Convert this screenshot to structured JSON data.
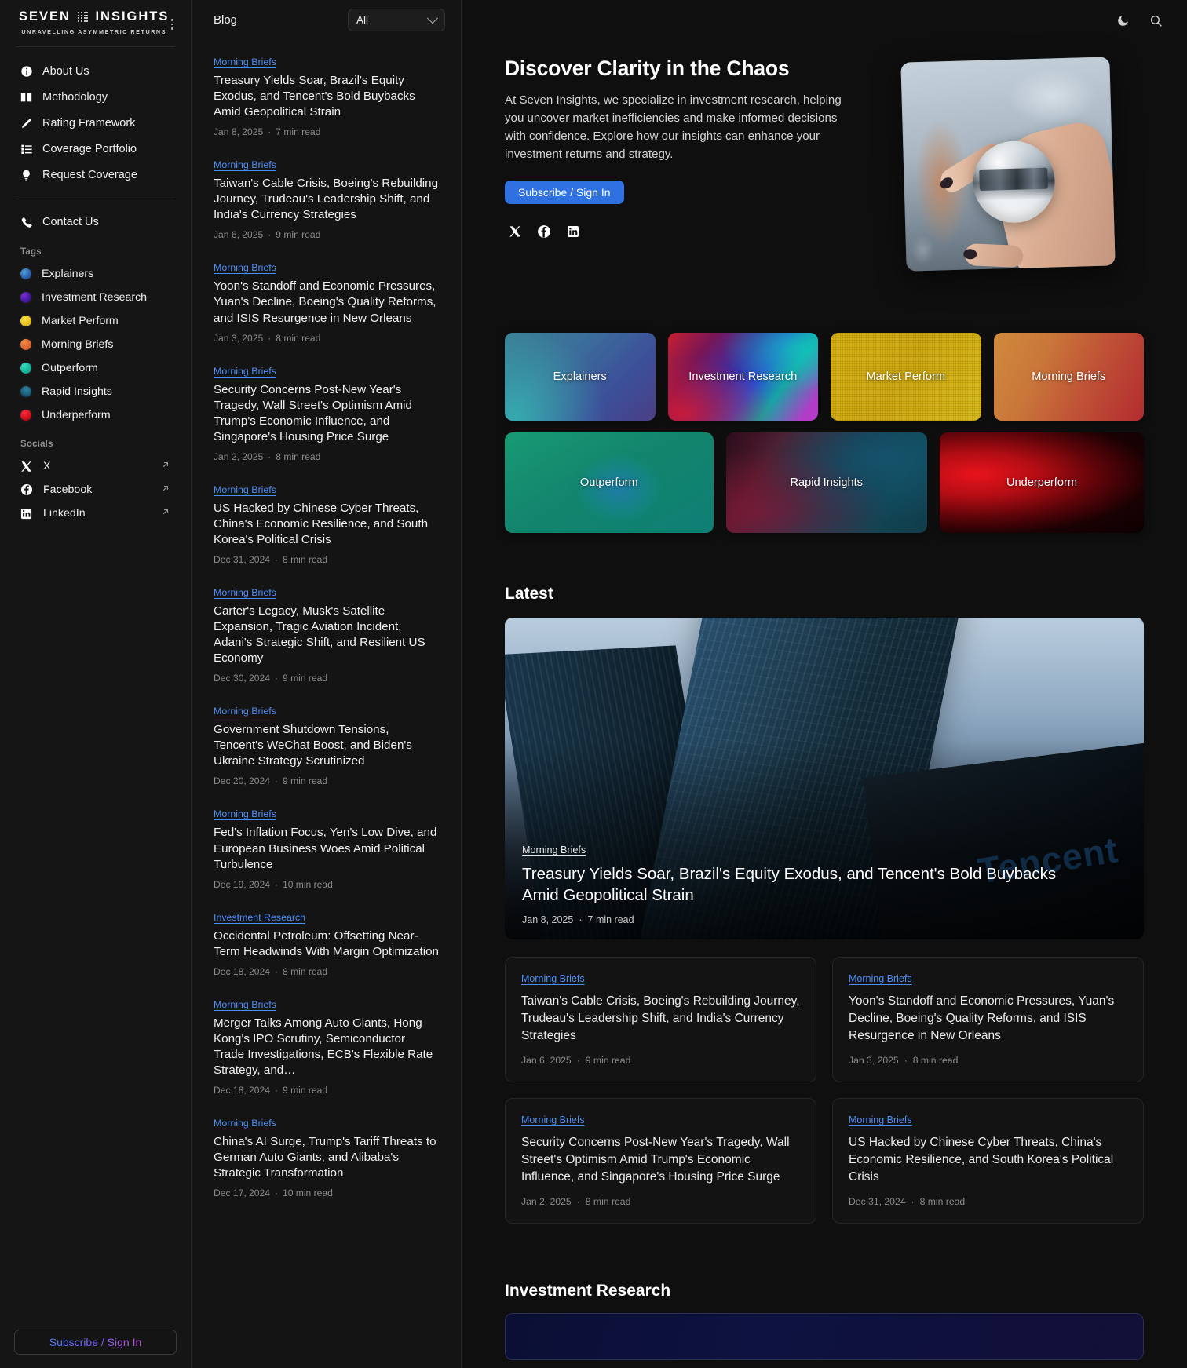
{
  "brand": {
    "word1": "SEVEN",
    "word2": "INSIGHTS",
    "tagline": "UNRAVELLING ASYMMETRIC RETURNS",
    "menu_icon": "kebab-menu-icon"
  },
  "sidebar": {
    "nav": [
      {
        "label": "About Us",
        "icon": "info-icon"
      },
      {
        "label": "Methodology",
        "icon": "book-icon"
      },
      {
        "label": "Rating Framework",
        "icon": "pencil-icon"
      },
      {
        "label": "Coverage Portfolio",
        "icon": "list-icon"
      },
      {
        "label": "Request Coverage",
        "icon": "bulb-icon"
      },
      {
        "label": "Contact Us",
        "icon": "phone-icon"
      }
    ],
    "tags_label": "Tags",
    "tags": [
      {
        "label": "Explainers",
        "color": "#2f7fc4"
      },
      {
        "label": "Investment Research",
        "color": "#5b1fb0"
      },
      {
        "label": "Market Perform",
        "color": "#e9c41a"
      },
      {
        "label": "Morning Briefs",
        "color": "#e06a34"
      },
      {
        "label": "Outperform",
        "color": "#15b89a"
      },
      {
        "label": "Rapid Insights",
        "color": "#1d6f86"
      },
      {
        "label": "Underperform",
        "color": "#d81322"
      }
    ],
    "socials_label": "Socials",
    "socials": [
      {
        "label": "X",
        "icon": "x-icon"
      },
      {
        "label": "Facebook",
        "icon": "facebook-icon"
      },
      {
        "label": "LinkedIn",
        "icon": "linkedin-icon"
      }
    ],
    "subscribe_label": "Subscribe / Sign In"
  },
  "blog": {
    "title": "Blog",
    "filter_value": "All",
    "filter_options": [
      "All"
    ],
    "posts": [
      {
        "tag": "Morning Briefs",
        "title": "Treasury Yields Soar, Brazil's Equity Exodus, and Tencent's Bold Buybacks Amid Geopolitical Strain",
        "date": "Jan 8, 2025",
        "read": "7 min read"
      },
      {
        "tag": "Morning Briefs",
        "title": "Taiwan's Cable Crisis, Boeing's Rebuilding Journey, Trudeau's Leadership Shift, and India's Currency Strategies",
        "date": "Jan 6, 2025",
        "read": "9 min read"
      },
      {
        "tag": "Morning Briefs",
        "title": "Yoon's Standoff and Economic Pressures, Yuan's Decline, Boeing's Quality Reforms, and ISIS Resurgence in New Orleans",
        "date": "Jan 3, 2025",
        "read": "8 min read"
      },
      {
        "tag": "Morning Briefs",
        "title": "Security Concerns Post-New Year's Tragedy, Wall Street's Optimism Amid Trump's Economic Influence, and Singapore's Housing Price Surge",
        "date": "Jan 2, 2025",
        "read": "8 min read"
      },
      {
        "tag": "Morning Briefs",
        "title": "US Hacked by Chinese Cyber Threats, China's Economic Resilience, and South Korea's Political Crisis",
        "date": "Dec 31, 2024",
        "read": "8 min read"
      },
      {
        "tag": "Morning Briefs",
        "title": "Carter's Legacy, Musk's Satellite Expansion, Tragic Aviation Incident, Adani's Strategic Shift, and Resilient US Economy",
        "date": "Dec 30, 2024",
        "read": "9 min read"
      },
      {
        "tag": "Morning Briefs",
        "title": "Government Shutdown Tensions, Tencent's WeChat Boost, and Biden's Ukraine Strategy Scrutinized",
        "date": "Dec 20, 2024",
        "read": "9 min read"
      },
      {
        "tag": "Morning Briefs",
        "title": "Fed's Inflation Focus, Yen's Low Dive, and European Business Woes Amid Political Turbulence",
        "date": "Dec 19, 2024",
        "read": "10 min read"
      },
      {
        "tag": "Investment Research",
        "title": "Occidental Petroleum: Offsetting Near-Term Headwinds With Margin Optimization",
        "date": "Dec 18, 2024",
        "read": "8 min read"
      },
      {
        "tag": "Morning Briefs",
        "title": "Merger Talks Among Auto Giants, Hong Kong's IPO Scrutiny, Semiconductor Trade Investigations, ECB's Flexible Rate Strategy, and…",
        "date": "Dec 18, 2024",
        "read": "9 min read"
      },
      {
        "tag": "Morning Briefs",
        "title": "China's AI Surge, Trump's Tariff Threats to German Auto Giants, and Alibaba's Strategic Transformation",
        "date": "Dec 17, 2024",
        "read": "10 min read"
      }
    ]
  },
  "topbar": {
    "theme_toggle": "moon-icon",
    "search": "search-icon"
  },
  "hero": {
    "heading": "Discover Clarity in the Chaos",
    "paragraph": "At Seven Insights, we specialize in investment research, helping you uncover market inefficiencies and make informed decisions with confidence. Explore how our insights can enhance your investment returns and strategy.",
    "cta_label": "Subscribe / Sign In",
    "cta_color": "#2f71e0",
    "socials": [
      {
        "label": "X",
        "icon": "x-icon"
      },
      {
        "label": "Facebook",
        "icon": "facebook-icon"
      },
      {
        "label": "LinkedIn",
        "icon": "linkedin-icon"
      }
    ],
    "image_alt": "hand-holding-glass-lens-ball"
  },
  "categories": {
    "row1": [
      {
        "label": "Explainers"
      },
      {
        "label": "Investment Research"
      },
      {
        "label": "Market Perform"
      },
      {
        "label": "Morning Briefs"
      }
    ],
    "row2": [
      {
        "label": "Outperform"
      },
      {
        "label": "Rapid Insights"
      },
      {
        "label": "Underperform"
      }
    ]
  },
  "latest": {
    "heading": "Latest",
    "feature": {
      "tag": "Morning Briefs",
      "title": "Treasury Yields Soar, Brazil's Equity Exodus, and Tencent's Bold Buybacks Amid Geopolitical Strain",
      "date": "Jan 8, 2025",
      "read": "7 min read",
      "image_alt": "tencent-skyscraper-photo",
      "image_text": "Tencent"
    },
    "cards": [
      {
        "tag": "Morning Briefs",
        "title": "Taiwan's Cable Crisis, Boeing's Rebuilding Journey, Trudeau's Leadership Shift, and India's Currency Strategies",
        "date": "Jan 6, 2025",
        "read": "9 min read"
      },
      {
        "tag": "Morning Briefs",
        "title": "Yoon's Standoff and Economic Pressures, Yuan's Decline, Boeing's Quality Reforms, and ISIS Resurgence in New Orleans",
        "date": "Jan 3, 2025",
        "read": "8 min read"
      },
      {
        "tag": "Morning Briefs",
        "title": "Security Concerns Post-New Year's Tragedy, Wall Street's Optimism Amid Trump's Economic Influence, and Singapore's Housing Price Surge",
        "date": "Jan 2, 2025",
        "read": "8 min read"
      },
      {
        "tag": "Morning Briefs",
        "title": "US Hacked by Chinese Cyber Threats, China's Economic Resilience, and South Korea's Political Crisis",
        "date": "Dec 31, 2024",
        "read": "8 min read"
      }
    ]
  },
  "investment_research": {
    "heading": "Investment Research"
  }
}
